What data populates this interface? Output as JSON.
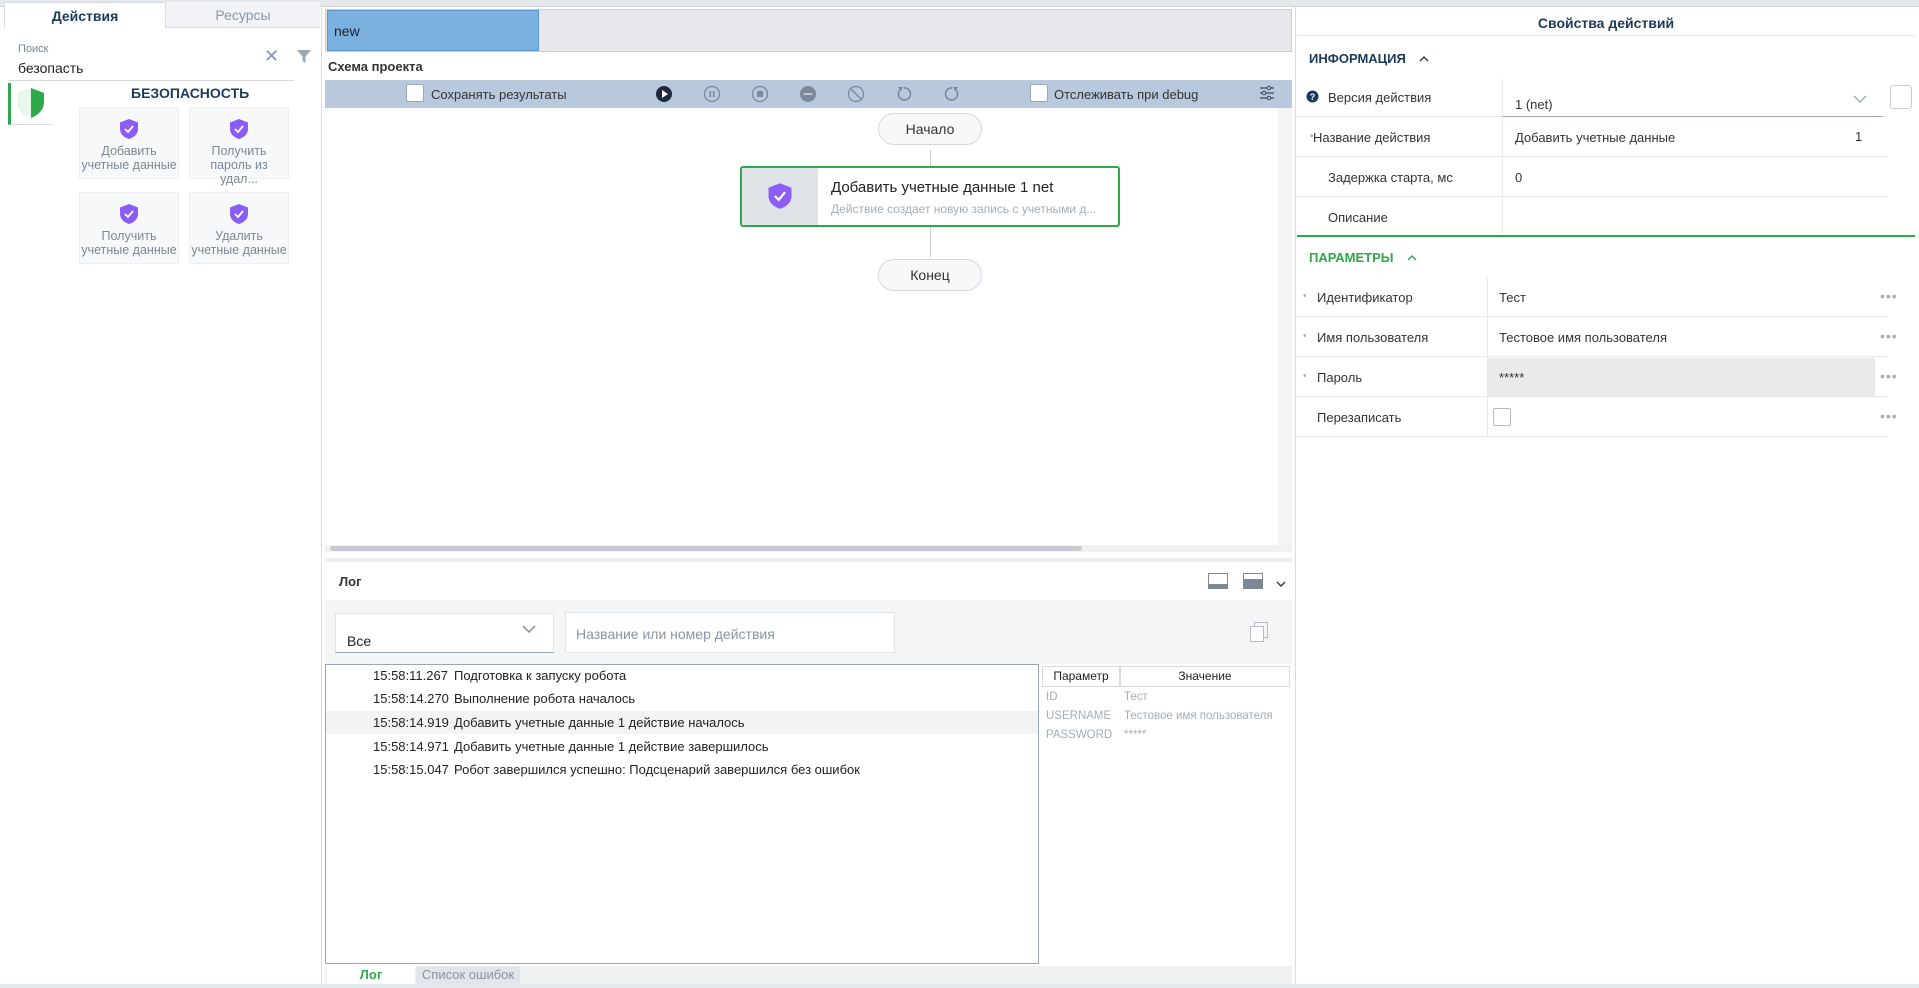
{
  "left": {
    "tab_actions": "Действия",
    "tab_resources": "Ресурсы",
    "search_label": "Поиск",
    "search_value": "безопасть",
    "category_title": "БЕЗОПАСНОСТЬ",
    "cards": [
      {
        "line1": "Добавить",
        "line2": "учетные данные"
      },
      {
        "line1": "Получить",
        "line2": "пароль из удал..."
      },
      {
        "line1": "Получить",
        "line2": "учетные данные"
      },
      {
        "line1": "Удалить",
        "line2": "учетные данные"
      }
    ]
  },
  "center": {
    "tab_name": "new",
    "scheme_title": "Схема проекта",
    "save_results": "Сохранять результаты",
    "track_debug": "Отслеживать при debug",
    "start_node": "Начало",
    "end_node": "Конец",
    "node": {
      "title": "Добавить учетные данные  1  net",
      "desc": "Действие создает новую запись с учетными д..."
    }
  },
  "log": {
    "title": "Лог",
    "filter_value": "Все",
    "search_placeholder": "Название или номер действия",
    "rows": [
      {
        "time": "15:58:11.267",
        "msg": "Подготовка к запуску робота"
      },
      {
        "time": "15:58:14.270",
        "msg": "Выполнение робота началось"
      },
      {
        "time": "15:58:14.919",
        "msg": "Добавить учетные данные 1 действие началось"
      },
      {
        "time": "15:58:14.971",
        "msg": "Добавить учетные данные 1 действие завершилось"
      },
      {
        "time": "15:58:15.047",
        "msg": "Робот завершился успешно: Подсценарий завершился без ошибок"
      }
    ],
    "param_header": "Параметр",
    "value_header": "Значение",
    "params": [
      {
        "k": "ID",
        "v": "Тест"
      },
      {
        "k": "USERNAME",
        "v": "Тестовое имя пользователя"
      },
      {
        "k": "PASSWORD",
        "v": "*****"
      }
    ],
    "tab_log": "Лог",
    "tab_errors": "Список ошибок"
  },
  "right": {
    "title": "Свойства действий",
    "info_section": "ИНФОРМАЦИЯ",
    "version_label": "Версия действия",
    "version_value": "1 (net)",
    "name_label": "Название действия",
    "name_value": "Добавить учетные данные",
    "name_number": "1",
    "delay_label": "Задержка старта, мс",
    "delay_value": "0",
    "desc_label": "Описание",
    "desc_value": "",
    "params_section": "ПАРАМЕТРЫ",
    "p_id_label": "Идентификатор",
    "p_id_value": "Тест",
    "p_user_label": "Имя пользователя",
    "p_user_value": "Тестовое имя пользователя",
    "p_pass_label": "Пароль",
    "p_pass_value": "*****",
    "p_over_label": "Перезаписать"
  },
  "colors": {
    "accent_green": "#2ea84a",
    "shield_purple": "#8b5cf6",
    "tab_blue": "#7ab1e0"
  }
}
